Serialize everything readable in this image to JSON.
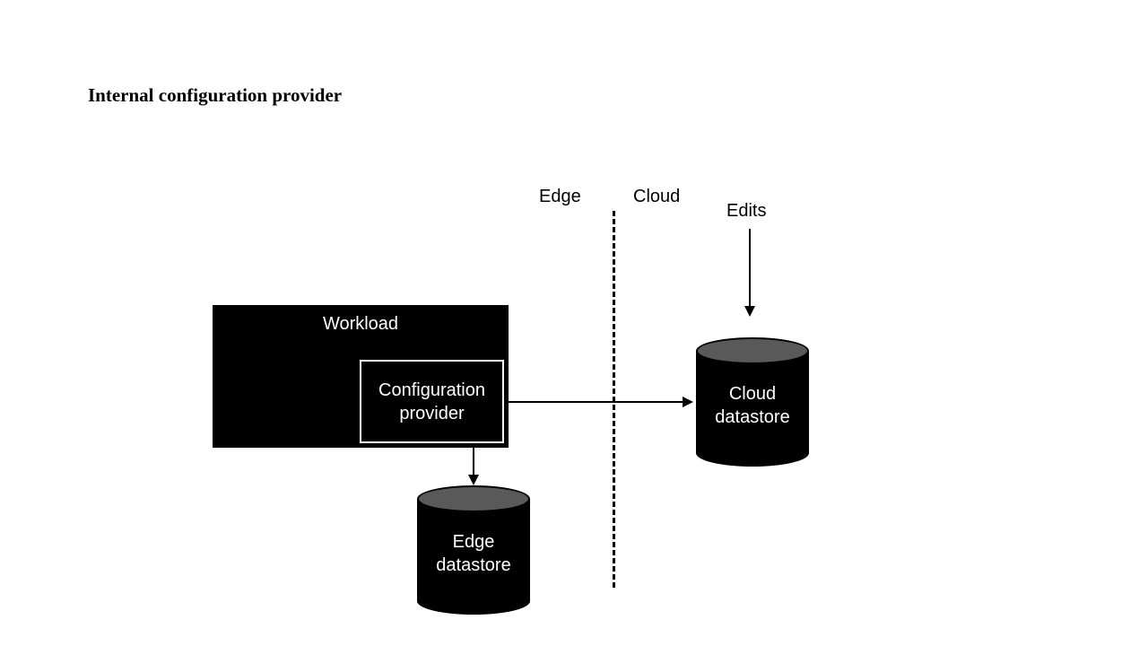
{
  "title": "Internal configuration provider",
  "labels": {
    "edge": "Edge",
    "cloud": "Cloud",
    "edits": "Edits"
  },
  "workload": {
    "title": "Workload",
    "configProvider": "Configuration\nprovider"
  },
  "edgeDatastore": "Edge\ndatastore",
  "cloudDatastore": "Cloud\ndatastore"
}
